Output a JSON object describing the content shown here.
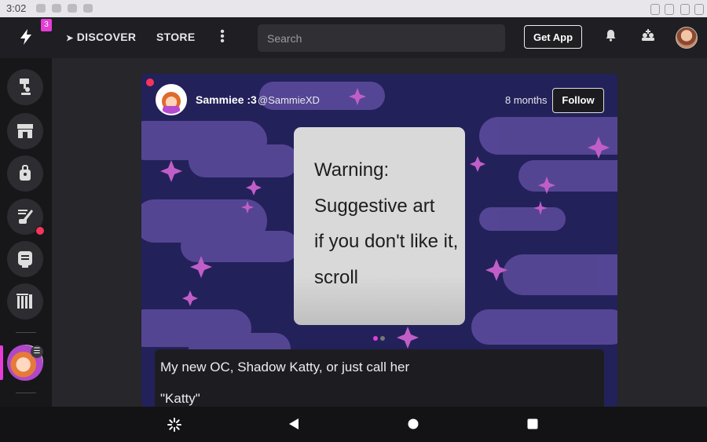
{
  "status_bar": {
    "time": "3:02"
  },
  "topbar": {
    "logo_icon": "lightning-logo-icon",
    "notification_badge": "3",
    "nav": {
      "discover": "DISCOVER",
      "store": "STORE"
    },
    "search": {
      "placeholder": "Search",
      "value": ""
    },
    "get_app": "Get App",
    "icons": [
      "bell-icon",
      "add-friend-icon",
      "user-avatar"
    ]
  },
  "sidebar": {
    "items": [
      {
        "name": "home-icon"
      },
      {
        "name": "store-icon"
      },
      {
        "name": "bag-icon"
      },
      {
        "name": "art-icon",
        "has_notification": true
      },
      {
        "name": "chat-icon"
      },
      {
        "name": "library-icon"
      }
    ],
    "active_avatar": "community-avatar"
  },
  "post": {
    "author": {
      "name": "Sammiee :3",
      "handle": "@SammieXD"
    },
    "time": "8 months",
    "follow_label": "Follow",
    "image_text": [
      "Warning:",
      "Suggestive art",
      "if you don't like it,",
      "scroll"
    ],
    "pager": {
      "count": 2,
      "active": 0,
      "active_color": "#e53dd6",
      "inactive_color": "#777777"
    },
    "caption": [
      "My new OC, Shadow Katty, or just call her",
      "\"Katty\""
    ]
  },
  "colors": {
    "accent": "#e53dd6",
    "notification": "#f5365c",
    "card_bg": "#23215a",
    "cloud": "#5b4a9c"
  },
  "android_nav": [
    "pinwheel-icon",
    "back-icon",
    "home-circle-icon",
    "recents-icon"
  ]
}
